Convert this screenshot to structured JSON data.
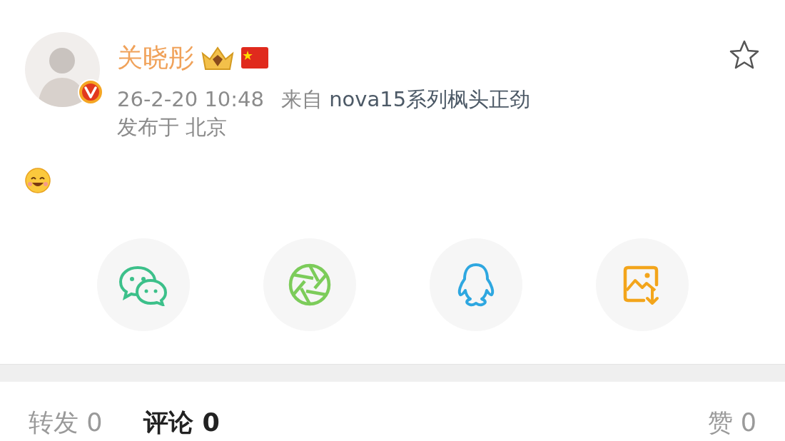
{
  "post": {
    "author": {
      "name": "关晓彤",
      "verified": true
    },
    "time": "26-2-20 10:48",
    "source_prefix": "来自",
    "source": "nova15系列枫头正劲",
    "location": "发布于 北京",
    "starred": false
  },
  "share_targets": [
    {
      "kind": "wechat"
    },
    {
      "kind": "moments"
    },
    {
      "kind": "qq"
    },
    {
      "kind": "save_image"
    }
  ],
  "tabs": [
    {
      "label": "转发 0",
      "selected": false
    },
    {
      "label": "评论 0",
      "selected": true
    },
    {
      "label": "赞 0",
      "selected": false
    }
  ]
}
